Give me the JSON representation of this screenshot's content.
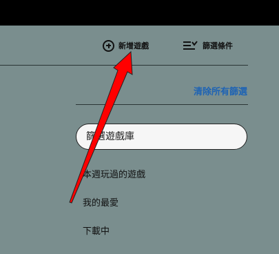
{
  "toolbar": {
    "add_game_label": "新增遊戲",
    "filter_label": "篩選條件"
  },
  "filters": {
    "clear_all_label": "清除所有篩選"
  },
  "search": {
    "placeholder": "篩選遊戲庫"
  },
  "library_list": {
    "items": [
      {
        "label": "本週玩過的遊戲"
      },
      {
        "label": "我的最愛"
      },
      {
        "label": "下載中"
      }
    ]
  },
  "annotation": {
    "arrow_color": "#ff0000",
    "points_to": "add-game-button"
  },
  "colors": {
    "background": "#7a8e8e",
    "topbar": "#000000",
    "link": "#1e63b4"
  }
}
